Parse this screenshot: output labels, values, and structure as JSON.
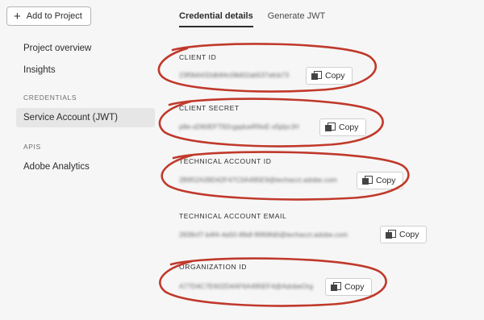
{
  "sidebar": {
    "add_button": "Add to Project",
    "items": [
      {
        "label": "Project overview"
      },
      {
        "label": "Insights"
      },
      {
        "label": "Service Account (JWT)"
      },
      {
        "label": "Adobe Analytics"
      }
    ],
    "headings": [
      "CREDENTIALS",
      "APIS"
    ]
  },
  "tabs": [
    "Credential details",
    "Generate JWT"
  ],
  "fields": [
    {
      "label": "CLIENT ID",
      "value": "23f0b6432db94c08d02ab537afcb73",
      "copy": "Copy"
    },
    {
      "label": "CLIENT SECRET",
      "value": "p8e-sD60EFT92cgqdueRNxE-s5jdyrJH",
      "copy": "Copy"
    },
    {
      "label": "TECHNICAL ACCOUNT ID",
      "value": "2B952A39D42F47C0A495E9@techacct.adobe.com",
      "copy": "Copy"
    },
    {
      "label": "TECHNICAL ACCOUNT EMAIL",
      "value": "2839cf7-b4f4-4a50-89df-f6f69fd0@techacct.adobe.com",
      "copy": "Copy"
    },
    {
      "label": "ORGANIZATION ID",
      "value": "A77D4C7E602D4AF6A495EF4@AdobeOrg",
      "copy": "Copy"
    }
  ],
  "colors": {
    "annotation": "#c0392b",
    "selected_bg": "#e6e6e6"
  }
}
